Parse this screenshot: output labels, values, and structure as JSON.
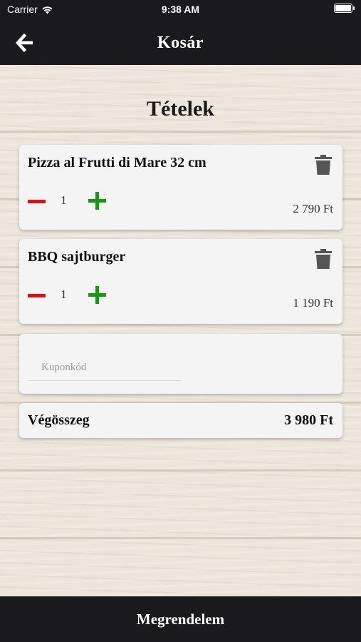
{
  "status_bar": {
    "carrier": "Carrier",
    "time": "9:38 AM"
  },
  "nav": {
    "title": "Kosár"
  },
  "cart": {
    "section_title": "Tételek",
    "items": [
      {
        "name": "Pizza al Frutti di Mare 32 cm",
        "quantity": "1",
        "price": "2 790 Ft"
      },
      {
        "name": "BBQ sajtburger",
        "quantity": "1",
        "price": "1 190 Ft"
      }
    ],
    "coupon": {
      "placeholder": "Kuponkód",
      "value": ""
    },
    "total": {
      "label": "Végösszeg",
      "value": "3 980 Ft"
    }
  },
  "order_button": {
    "label": "Megrendelem"
  },
  "colors": {
    "bar_background": "#1a1a1e",
    "minus": "#e01010",
    "plus": "#139a13",
    "card": "#f4f4f4",
    "icon_gray": "#555555"
  },
  "icons": {
    "back": "arrow-left-icon",
    "trash": "trash-icon",
    "wifi": "wifi-icon",
    "battery": "battery-icon"
  }
}
